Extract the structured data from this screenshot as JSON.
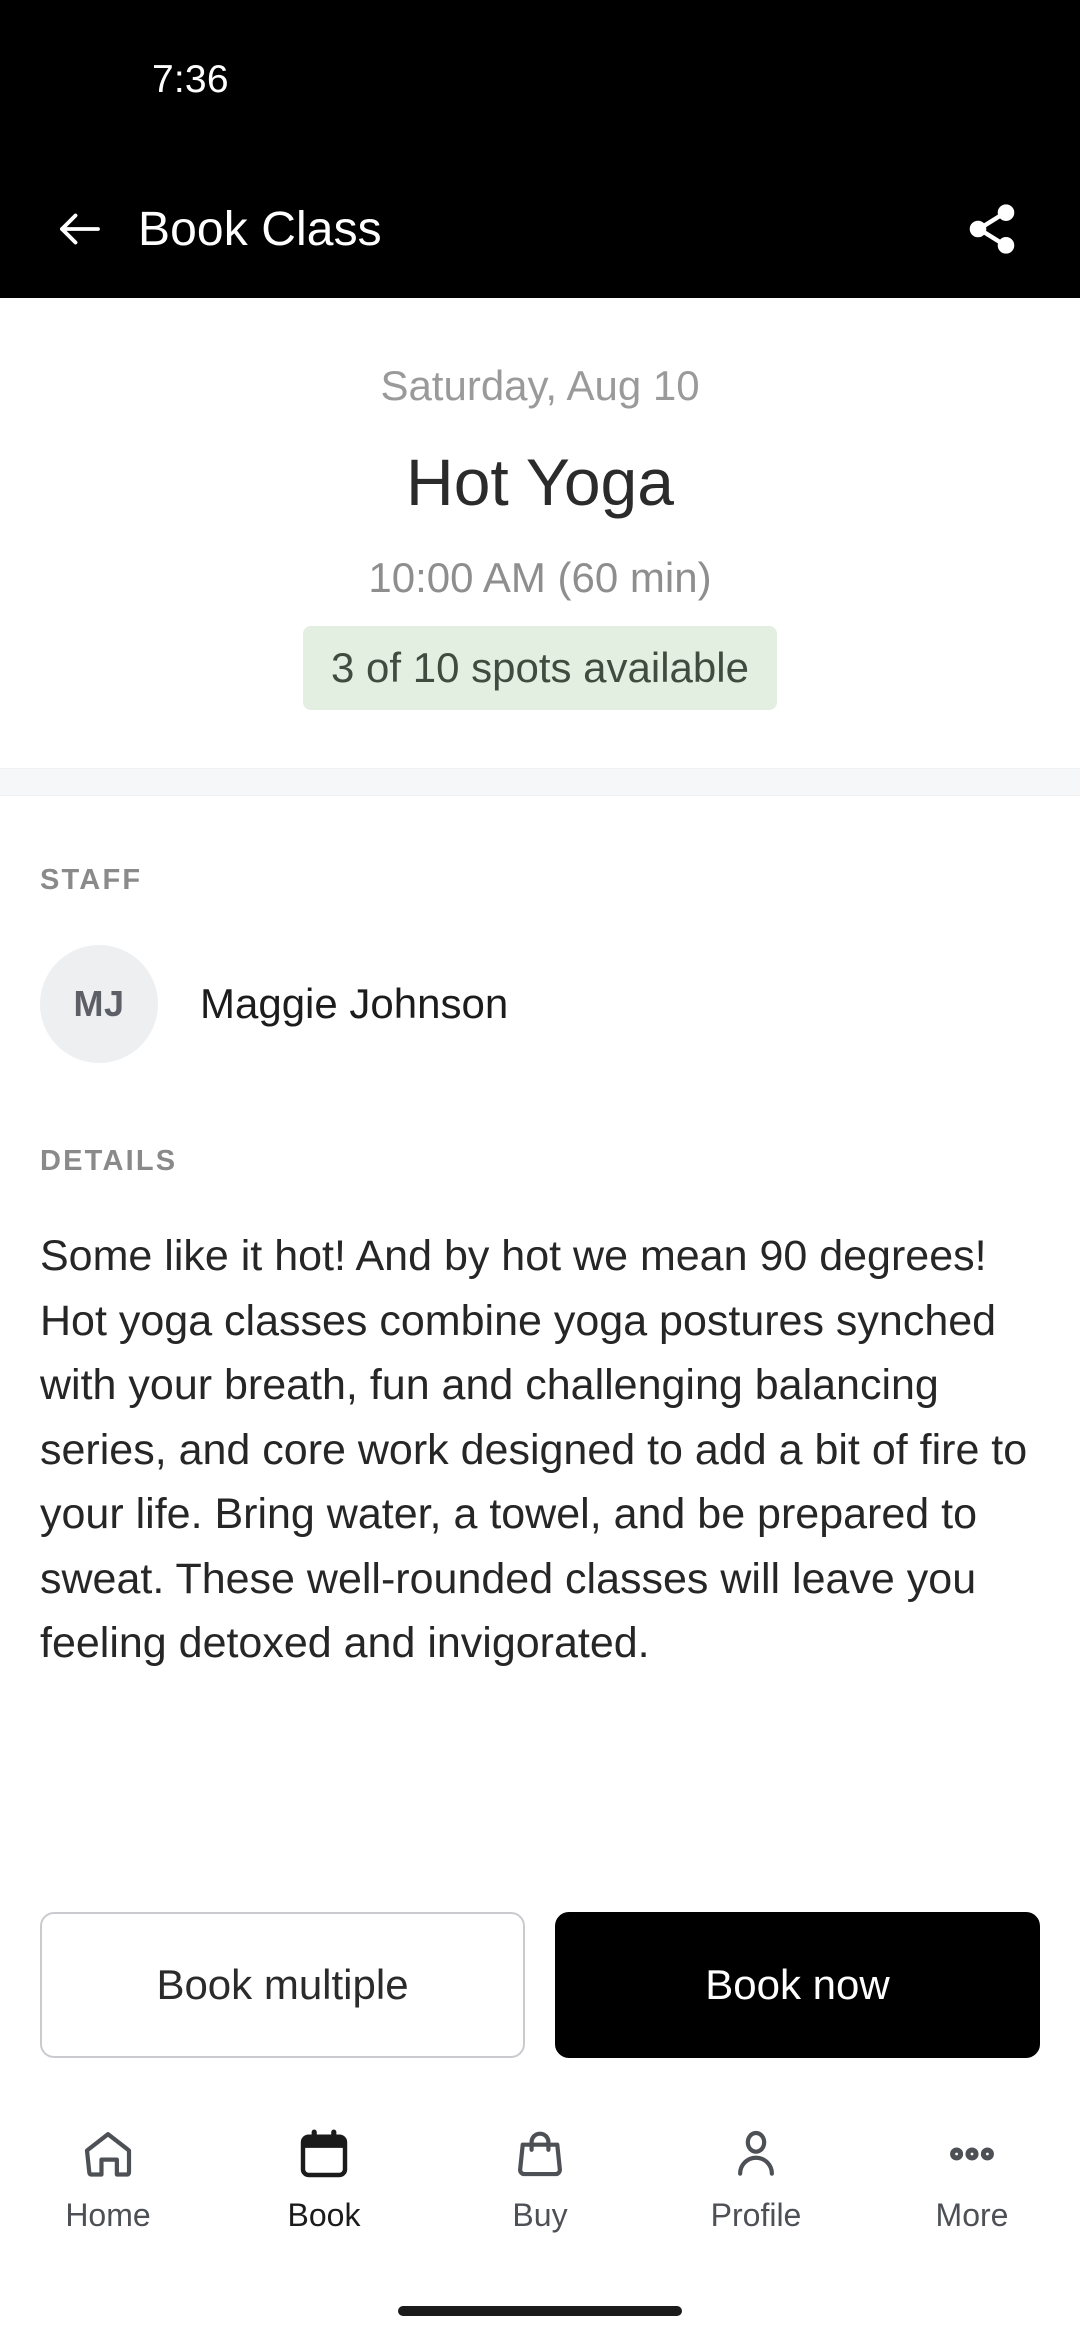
{
  "status_bar": {
    "time": "7:36"
  },
  "app_bar": {
    "title": "Book Class",
    "back_icon": "arrow-left-icon",
    "share_icon": "share-icon"
  },
  "class": {
    "date": "Saturday, Aug 10",
    "name": "Hot Yoga",
    "time": "10:00 AM (60 min)",
    "spots": "3 of 10 spots available",
    "spots_available": 3,
    "spots_total": 10,
    "badge_bg": "#e3efe1",
    "badge_text_color": "#404c40"
  },
  "staff": {
    "label": "STAFF",
    "members": [
      {
        "initials": "MJ",
        "name": "Maggie Johnson"
      }
    ]
  },
  "details": {
    "label": "DETAILS",
    "body": "Some like it hot! And by hot we mean 90 degrees! Hot yoga classes combine yoga postures synched with your breath, fun and challenging balancing series, and core work designed to add a bit of fire to your life. Bring water, a towel, and be prepared to sweat. These well-rounded classes will leave you feeling detoxed and invigorated."
  },
  "actions": {
    "secondary_label": "Book multiple",
    "primary_label": "Book now"
  },
  "bottom_nav": {
    "items": [
      {
        "label": "Home",
        "icon": "home-icon",
        "active": false
      },
      {
        "label": "Book",
        "icon": "calendar-icon",
        "active": true
      },
      {
        "label": "Buy",
        "icon": "shopping-bag-icon",
        "active": false
      },
      {
        "label": "Profile",
        "icon": "person-icon",
        "active": false
      },
      {
        "label": "More",
        "icon": "more-horizontal-icon",
        "active": false
      }
    ]
  }
}
